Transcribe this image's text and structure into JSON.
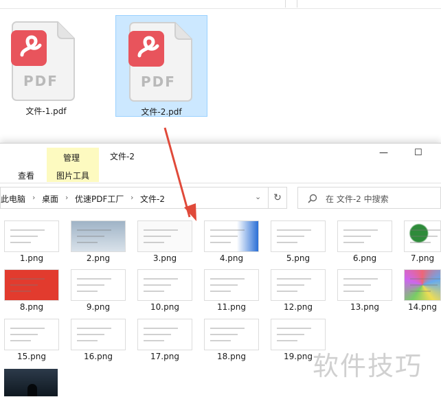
{
  "top_window": {
    "files": [
      {
        "name": "文件-1.pdf",
        "selected": false,
        "icon": "pdf-file-icon"
      },
      {
        "name": "文件-2.pdf",
        "selected": true,
        "icon": "pdf-file-icon"
      }
    ],
    "pdf_badge_text": "PDF"
  },
  "bottom_window": {
    "ribbon": {
      "context_group_label": "管理",
      "context_tab_label": "图片工具",
      "view_tab_label": "查看",
      "window_title": "文件-2"
    },
    "window_controls": {
      "minimize": "—",
      "maximize": "☐"
    },
    "address": {
      "crumbs": [
        "此电脑",
        "桌面",
        "优速PDF工厂",
        "文件-2"
      ],
      "refresh_icon": "refresh-icon"
    },
    "search": {
      "placeholder": "在 文件-2 中搜索"
    },
    "thumbnails": [
      {
        "label": "1.png"
      },
      {
        "label": "2.png"
      },
      {
        "label": "3.png"
      },
      {
        "label": "4.png"
      },
      {
        "label": "5.png"
      },
      {
        "label": "6.png"
      },
      {
        "label": "7.png"
      },
      {
        "label": "8.png"
      },
      {
        "label": "9.png"
      },
      {
        "label": "10.png"
      },
      {
        "label": "11.png"
      },
      {
        "label": "12.png"
      },
      {
        "label": "13.png"
      },
      {
        "label": "14.png"
      },
      {
        "label": "15.png"
      },
      {
        "label": "16.png"
      },
      {
        "label": "17.png"
      },
      {
        "label": "18.png"
      },
      {
        "label": "19.png"
      }
    ]
  },
  "watermark": "软件技巧",
  "colors": {
    "accent_pdf": "#e8545c",
    "selection": "#cce8ff",
    "context_tab": "#fdfac0",
    "arrow": "#e04a3a"
  }
}
